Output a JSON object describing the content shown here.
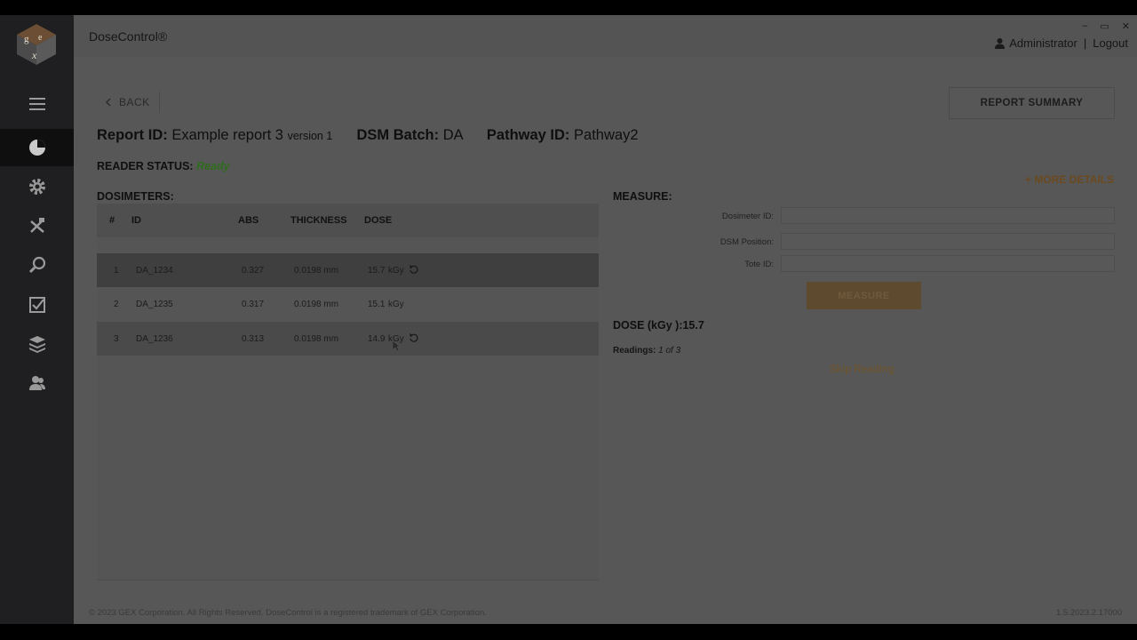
{
  "app": {
    "title": "DoseControl®",
    "window_controls": [
      "–",
      "▭",
      "✕"
    ]
  },
  "user": {
    "name": "Administrator",
    "separator": "|",
    "logout": "Logout"
  },
  "sidebar": {
    "items": [
      {
        "name": "menu-icon",
        "active": false
      },
      {
        "name": "dashboard-icon",
        "active": true
      },
      {
        "name": "settings-icon",
        "active": false
      },
      {
        "name": "tools-icon",
        "active": false
      },
      {
        "name": "search-icon",
        "active": false
      },
      {
        "name": "checklist-icon",
        "active": false
      },
      {
        "name": "layers-icon",
        "active": false
      },
      {
        "name": "users-icon",
        "active": false
      }
    ]
  },
  "nav": {
    "back_label": "BACK",
    "report_summary_label": "REPORT SUMMARY"
  },
  "report": {
    "id_label": "Report ID:",
    "id_value": "Example report 3",
    "version": "version 1",
    "batch_label": "DSM Batch:",
    "batch_value": "DA",
    "pathway_label": "Pathway ID:",
    "pathway_value": "Pathway2"
  },
  "reader": {
    "label": "READER STATUS:",
    "status": "Ready",
    "status_color": "#3ea829"
  },
  "more_details": "+ MORE DETAILS",
  "dosimeters": {
    "title": "DOSIMETERS:",
    "columns": [
      "#",
      "ID",
      "ABS",
      "THICKNESS",
      "DOSE"
    ],
    "rows": [
      {
        "num": "1",
        "id": "DA_1234",
        "abs": "0.327",
        "thickness": "0.0198 mm",
        "dose": "15.7",
        "unit": "kGy",
        "reset": true
      },
      {
        "num": "2",
        "id": "DA_1235",
        "abs": "0.317",
        "thickness": "0.0198 mm",
        "dose": "15.1",
        "unit": "kGy",
        "reset": false
      },
      {
        "num": "3",
        "id": "DA_1236",
        "abs": "0.313",
        "thickness": "0.0198 mm",
        "dose": "14.9",
        "unit": "kGy",
        "reset": true
      }
    ]
  },
  "measure": {
    "title": "MEASURE:",
    "fields": [
      {
        "label": "Dosimeter ID:",
        "value": ""
      },
      {
        "label": "DSM Position:",
        "value": ""
      },
      {
        "label": "Tote ID:",
        "value": ""
      }
    ],
    "button": "MEASURE",
    "dose_text": "DOSE (kGy ):15.7",
    "readings_label": "Readings:",
    "readings_value": "1 of 3",
    "skip_label": "Skip Reading"
  },
  "footer": {
    "copyright": "© 2023 GEX Corporation. All Rights Reserved. DoseControl is a registered trademark of GEX Corporation.",
    "version": "1.5.2023.2.17000"
  },
  "colors": {
    "accent": "#e8963c",
    "sidebar": "#1f1f21",
    "overlay": "dimmed"
  }
}
